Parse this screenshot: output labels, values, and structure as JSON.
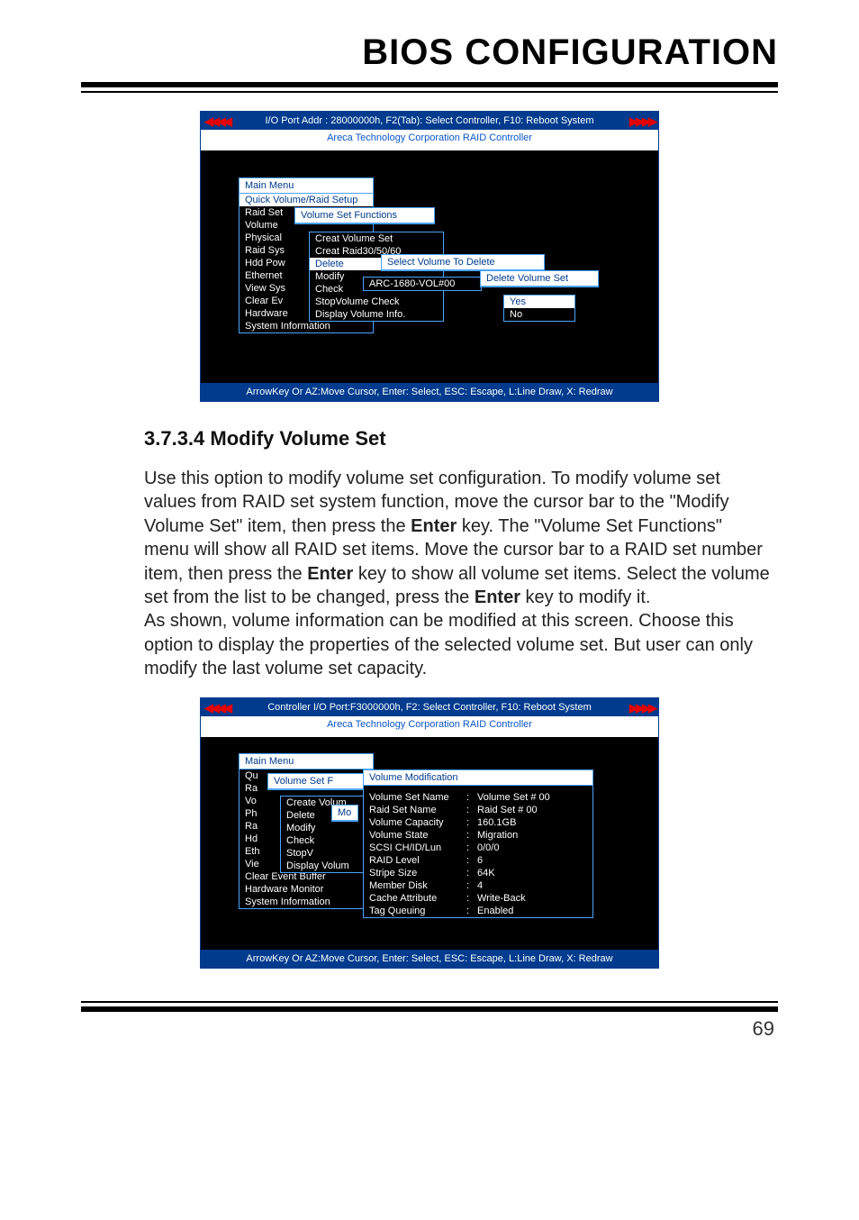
{
  "page": {
    "title": "BIOS CONFIGURATION",
    "number": "69"
  },
  "screenshot1": {
    "topbar": "I/O Port Addr : 28000000h, F2(Tab): Select Controller, F10: Reboot System",
    "subtitle": "Areca Technology Corporation RAID Controller",
    "mainmenu_title": "Main Menu",
    "mainmenu_items": [
      "Quick Volume/Raid Setup",
      "Raid Set",
      "Volume",
      "Physical",
      "Raid Sys",
      "Hdd Pow",
      "Ethernet",
      "View Sys",
      "Clear Ev",
      "Hardware",
      "System Information"
    ],
    "vsf_title": "Volume Set Functions",
    "vsf_items": [
      "Creat Volume Set",
      "Creat Raid30/50/60",
      "Delete",
      "Modify",
      "Check",
      "StopVolume Check",
      "Display Volume Info."
    ],
    "select_title": "Select Volume To Delete",
    "arc_item": "ARC-1680-VOL#00",
    "delete_title": "Delete Volume Set",
    "yes": "Yes",
    "no": "No",
    "footer": "ArrowKey Or AZ:Move Cursor, Enter: Select, ESC: Escape, L:Line Draw, X: Redraw"
  },
  "section": {
    "heading": "3.7.3.4 Modify Volume Set",
    "para1a": "Use this option to modify volume set configuration. To modify volume set values from RAID set system function, move the cursor bar to the \"Modify Volume Set\" item, then press the ",
    "enter1": "Enter",
    "para1b": " key. The \"Volume Set Functions\" menu will show all RAID set items. Move the cursor bar to a RAID set number item, then press the ",
    "enter2": "Enter",
    "para1c": " key to show all volume set items.  Select the volume set from the list to be changed, press the ",
    "enter3": "Enter",
    "para1d": " key to modify it.",
    "para2": "As shown, volume information can be modified at this screen. Choose this option to display the properties of the selected volume set. But user can only modify the last volume set capacity."
  },
  "screenshot2": {
    "topbar": "Controller I/O Port:F3000000h, F2: Select Controller, F10: Reboot System",
    "subtitle": "Areca Technology Corporation RAID Controller",
    "mainmenu_title": "Main Menu",
    "mainmenu_items": [
      "Qu",
      "Ra",
      "Vo",
      "Ph",
      "Ra",
      "Hd",
      "Eth",
      "Vie",
      "Clear Event Buffer",
      "Hardware Monitor",
      "System Information"
    ],
    "vsf_title": "Volume Set F",
    "vsf_items": [
      "Create Volum",
      "Delete",
      "Modify",
      "Check",
      "StopV",
      "Display Volum"
    ],
    "mo": "Mo",
    "mod_title": "Volume Modification",
    "mod_rows": [
      {
        "k": "Volume Set Name",
        "v": "Volume Set  #  00"
      },
      {
        "k": "Raid Set Name",
        "v": "Raid Set  #  00"
      },
      {
        "k": "Volume Capacity",
        "v": "160.1GB"
      },
      {
        "k": "Volume State",
        "v": "Migration"
      },
      {
        "k": "SCSI  CH/ID/Lun",
        "v": "0/0/0"
      },
      {
        "k": "RAID Level",
        "v": "6"
      },
      {
        "k": "Stripe Size",
        "v": "64K"
      },
      {
        "k": "Member Disk",
        "v": "4"
      },
      {
        "k": "Cache Attribute",
        "v": "Write-Back"
      },
      {
        "k": "Tag Queuing",
        "v": "Enabled"
      }
    ],
    "footer": "ArrowKey Or AZ:Move Cursor, Enter: Select, ESC: Escape, L:Line Draw, X: Redraw"
  }
}
